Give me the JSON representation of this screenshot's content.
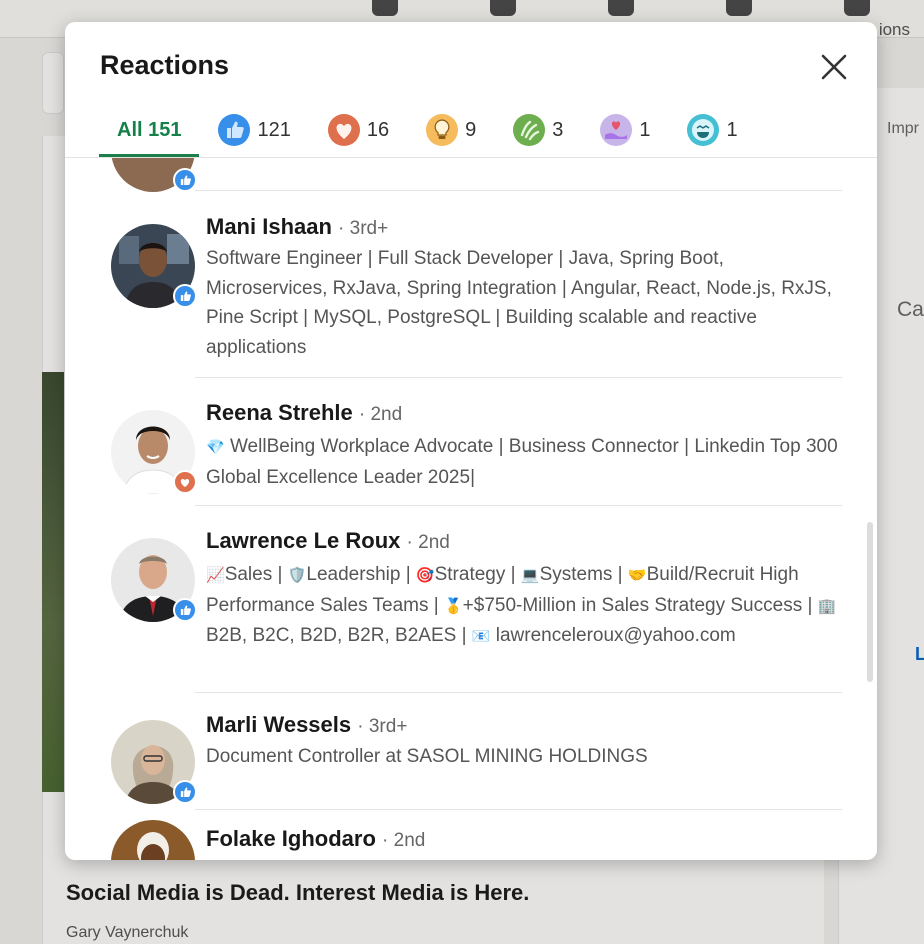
{
  "background": {
    "nav_partial_text": "ions",
    "right_partial_1": "Impr",
    "right_partial_2": "Ca",
    "right_partial_3": "L",
    "article_title": "Social Media is Dead. Interest Media is Here.",
    "article_author": "Gary Vaynerchuk"
  },
  "modal": {
    "title": "Reactions",
    "close_icon": "close-icon",
    "tabs": [
      {
        "label": "All 151",
        "icon": null,
        "active": true
      },
      {
        "label": "121",
        "icon": "like-icon",
        "color": "#378fe9"
      },
      {
        "label": "16",
        "icon": "love-icon",
        "color": "#df704d"
      },
      {
        "label": "9",
        "icon": "insightful-icon",
        "color": "#f5bb5c"
      },
      {
        "label": "3",
        "icon": "celebrate-icon",
        "color": "#6dae4f"
      },
      {
        "label": "1",
        "icon": "support-icon",
        "color": "#a872e8"
      },
      {
        "label": "1",
        "icon": "funny-icon",
        "color": "#44bfd3"
      }
    ],
    "people": [
      {
        "name": "Mani Ishaan",
        "degree": "· 3rd+",
        "reaction": "like-icon",
        "headline": "Software Engineer | Full Stack Developer | Java, Spring Boot, Microservices, RxJava, Spring Integration | Angular, React, Node.js, RxJS, Pine Script | MySQL, PostgreSQL | Building scalable and reactive applications"
      },
      {
        "name": "Reena Strehle",
        "degree": "· 2nd",
        "reaction": "love-icon",
        "headline_emoji": "💎",
        "headline": "WellBeing Workplace Advocate | Business Connector | Linkedin Top 300 Global Excellence Leader 2025|"
      },
      {
        "name": "Lawrence Le Roux",
        "degree": "· 2nd",
        "reaction": "like-icon",
        "headline_parts": [
          "📈",
          "Sales |",
          "🛡️",
          "Leadership |",
          "🎯",
          "Strategy |",
          "💻",
          "Systems |",
          "🤝",
          "Build/Recruit High Performance Sales Teams |",
          "🥇",
          "+$750-Million in Sales Strategy Success |",
          "🏢",
          "B2B, B2C, B2D, B2R, B2AES |",
          "📧",
          "lawrenceleroux@yahoo.com"
        ]
      },
      {
        "name": "Marli Wessels",
        "degree": "· 3rd+",
        "reaction": "like-icon",
        "headline": "Document Controller at SASOL MINING HOLDINGS"
      },
      {
        "name": "Folake Ighodaro",
        "degree": "· 2nd",
        "reaction": "",
        "headline": ""
      }
    ]
  }
}
